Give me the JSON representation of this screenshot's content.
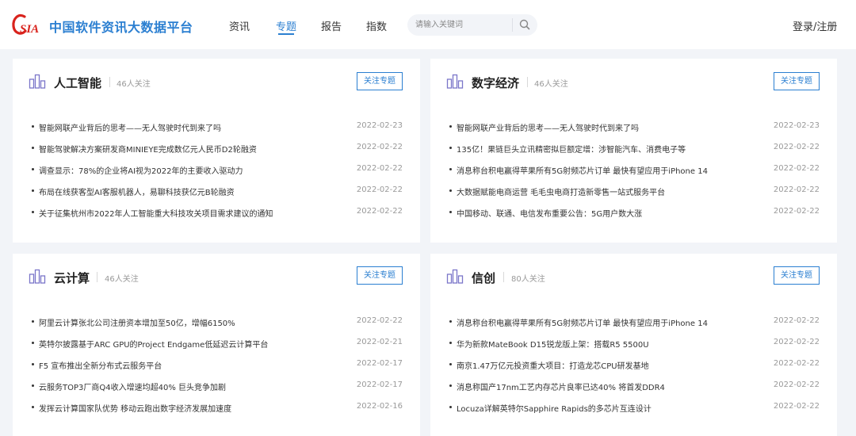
{
  "header": {
    "logo_text": "中国软件资讯大数据平台",
    "nav": [
      {
        "label": "资讯",
        "active": false
      },
      {
        "label": "专题",
        "active": true
      },
      {
        "label": "报告",
        "active": false
      },
      {
        "label": "指数",
        "active": false
      }
    ],
    "search_placeholder": "请输入关键词",
    "login_label": "登录",
    "login_sep": "/",
    "register_label": "注册"
  },
  "colors": {
    "accent": "#2b7fd1",
    "logo_red": "#d9231d",
    "topic_icon": "#7b76c9"
  },
  "topics": [
    {
      "title": "人工智能",
      "followers": "46人关注",
      "follow_label": "关注专题",
      "news": [
        {
          "title": "智能网联产业背后的思考——无人驾驶时代到来了吗",
          "date": "2022-02-23"
        },
        {
          "title": "智能驾驶解决方案研发商MINIEYE完成数亿元人民币D2轮融资",
          "date": "2022-02-22"
        },
        {
          "title": "调查显示：78%的企业将AI视为2022年的主要收入驱动力",
          "date": "2022-02-22"
        },
        {
          "title": "布局在线获客型AI客服机器人，易聊科技获亿元B轮融资",
          "date": "2022-02-22"
        },
        {
          "title": "关于征集杭州市2022年人工智能重大科技攻关项目需求建议的通知",
          "date": "2022-02-22"
        }
      ]
    },
    {
      "title": "数字经济",
      "followers": "46人关注",
      "follow_label": "关注专题",
      "news": [
        {
          "title": "智能网联产业背后的思考——无人驾驶时代到来了吗",
          "date": "2022-02-23"
        },
        {
          "title": "135亿！果链巨头立讯精密拟巨额定增：涉智能汽车、消费电子等",
          "date": "2022-02-22"
        },
        {
          "title": "消息称台积电赢得苹果所有5G射频芯片订单 最快有望应用于iPhone 14",
          "date": "2022-02-22"
        },
        {
          "title": "大数据赋能电商运营 毛毛虫电商打造新零售一站式服务平台",
          "date": "2022-02-22"
        },
        {
          "title": "中国移动、联通、电信发布重要公告：5G用户数大涨",
          "date": "2022-02-22"
        }
      ]
    },
    {
      "title": "云计算",
      "followers": "46人关注",
      "follow_label": "关注专题",
      "news": [
        {
          "title": "阿里云计算张北公司注册资本增加至50亿，增幅6150%",
          "date": "2022-02-22"
        },
        {
          "title": "英特尔披露基于ARC GPU的Project Endgame低延迟云计算平台",
          "date": "2022-02-21"
        },
        {
          "title": "F5 宣布推出全新分布式云服务平台",
          "date": "2022-02-17"
        },
        {
          "title": "云服务TOP3厂商Q4收入增速均超40% 巨头竞争加剧",
          "date": "2022-02-17"
        },
        {
          "title": "发挥云计算国家队优势 移动云跑出数字经济发展加速度",
          "date": "2022-02-16"
        }
      ]
    },
    {
      "title": "信创",
      "followers": "80人关注",
      "follow_label": "关注专题",
      "news": [
        {
          "title": "消息称台积电赢得苹果所有5G射频芯片订单 最快有望应用于iPhone 14",
          "date": "2022-02-22"
        },
        {
          "title": "华为新款MateBook D15锐龙版上架：搭载R5 5500U",
          "date": "2022-02-22"
        },
        {
          "title": "南京1.47万亿元投资重大项目：打造龙芯CPU研发基地",
          "date": "2022-02-22"
        },
        {
          "title": "消息称国产17nm工艺内存芯片良率已达40% 将首发DDR4",
          "date": "2022-02-22"
        },
        {
          "title": "Locuza详解英特尔Sapphire Rapids的多芯片互连设计",
          "date": "2022-02-22"
        }
      ]
    }
  ]
}
